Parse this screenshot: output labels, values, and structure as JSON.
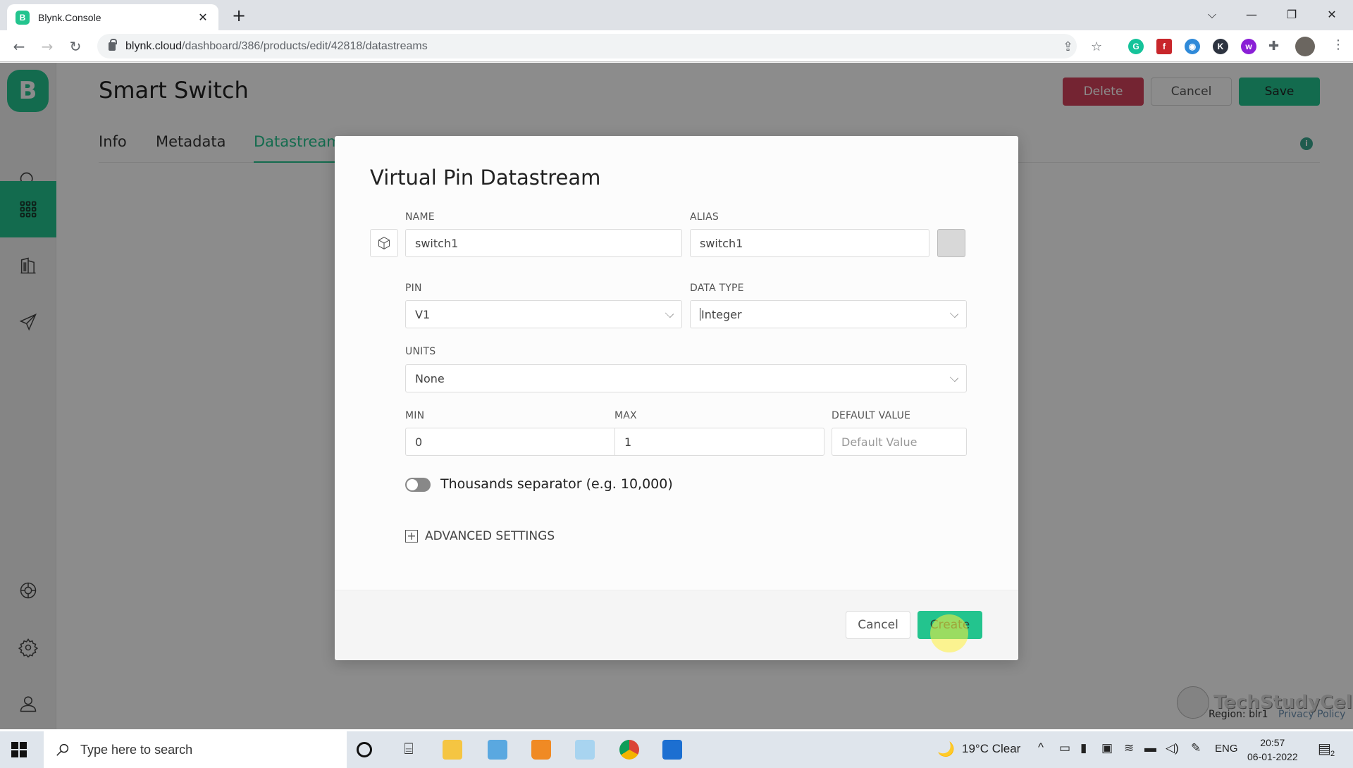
{
  "browser": {
    "tab_title": "Blynk.Console",
    "favicon_letter": "B",
    "url_host": "blynk.cloud",
    "url_path": "/dashboard/386/products/edit/42818/datastreams",
    "extensions": [
      {
        "name": "grammarly-icon",
        "glyph": "G",
        "color": "#15c39a"
      },
      {
        "name": "flash-icon",
        "glyph": "f",
        "color": "#c8262b"
      },
      {
        "name": "globe-icon",
        "glyph": "◉",
        "color": "#2f8ad9"
      },
      {
        "name": "k-extension-icon",
        "glyph": "K",
        "color": "#2d3340"
      },
      {
        "name": "w-extension-icon",
        "glyph": "w",
        "color": "#8a1fd6"
      }
    ]
  },
  "app": {
    "logo_letter": "B",
    "brand_color": "#23c48e",
    "product_title": "Smart Switch",
    "actions": {
      "delete": "Delete",
      "cancel": "Cancel",
      "save": "Save"
    },
    "tabs": [
      {
        "label": "Info",
        "active": false
      },
      {
        "label": "Metadata",
        "active": false
      },
      {
        "label": "Datastreams",
        "active": true
      }
    ],
    "sidebar": [
      {
        "name": "search",
        "active": false
      },
      {
        "name": "products",
        "active": true
      },
      {
        "name": "organizations",
        "active": false
      },
      {
        "name": "send",
        "active": false
      },
      {
        "name": "help",
        "active": false
      },
      {
        "name": "settings",
        "active": false
      },
      {
        "name": "user",
        "active": false
      }
    ],
    "footer": {
      "region": "Region: blr1",
      "privacy": "Privacy Policy"
    },
    "watermark": "TechStudyCell"
  },
  "modal": {
    "title": "Virtual Pin Datastream",
    "name": {
      "label": "NAME",
      "value": "switch1"
    },
    "alias": {
      "label": "ALIAS",
      "value": "switch1"
    },
    "pin": {
      "label": "PIN",
      "value": "V1"
    },
    "data_type": {
      "label": "DATA TYPE",
      "value": "Integer"
    },
    "units": {
      "label": "UNITS",
      "value": "None"
    },
    "min": {
      "label": "MIN",
      "value": "0"
    },
    "max": {
      "label": "MAX",
      "value": "1"
    },
    "default_value": {
      "label": "DEFAULT VALUE",
      "placeholder": "Default Value",
      "value": ""
    },
    "thousands_separator": {
      "label": "Thousands separator (e.g. 10,000)",
      "enabled": false
    },
    "advanced_settings": "ADVANCED SETTINGS",
    "cancel": "Cancel",
    "create": "Create"
  },
  "taskbar": {
    "search_placeholder": "Type here to search",
    "weather": "19°C  Clear",
    "language": "ENG",
    "time": "20:57",
    "date": "06-01-2022",
    "notifications": "2"
  }
}
